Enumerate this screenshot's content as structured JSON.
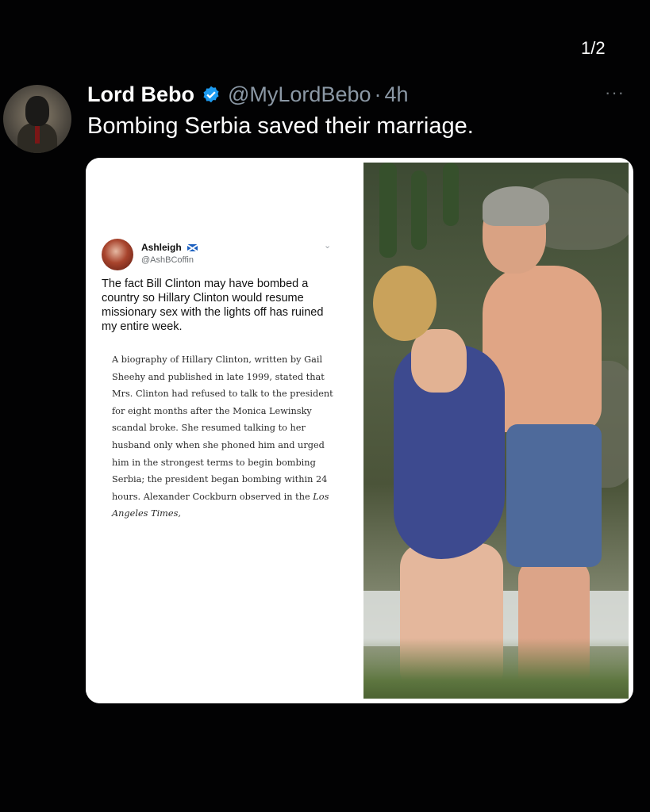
{
  "pager": "1/2",
  "more_label": "···",
  "tweet": {
    "author_name": "Lord Bebo",
    "handle": "@MyLordBebo",
    "separator": "·",
    "time": "4h",
    "text": "Bombing Serbia saved their marriage.",
    "verified_color": "#1d9bf0"
  },
  "quoted": {
    "author_name": "Ashleigh",
    "handle": "@AshBCoffin",
    "flag_icon": "scotland-flag-icon",
    "text": "The fact Bill Clinton may have bombed a country so Hillary Clinton would resume missionary sex with the lights off has ruined my entire week.",
    "excerpt": "A biography of Hillary Clinton, written by Gail Sheehy and published in late 1999, stated that Mrs. Clinton had refused to talk to the president for eight months after the Monica Lewinsky scandal broke. She resumed talking to her husband only when she phoned him and urged him in the strongest terms to begin bombing Serbia; the president began bombing within 24 hours. Alexander Cockburn observed in the",
    "excerpt_source": "Los Angeles Times,"
  }
}
